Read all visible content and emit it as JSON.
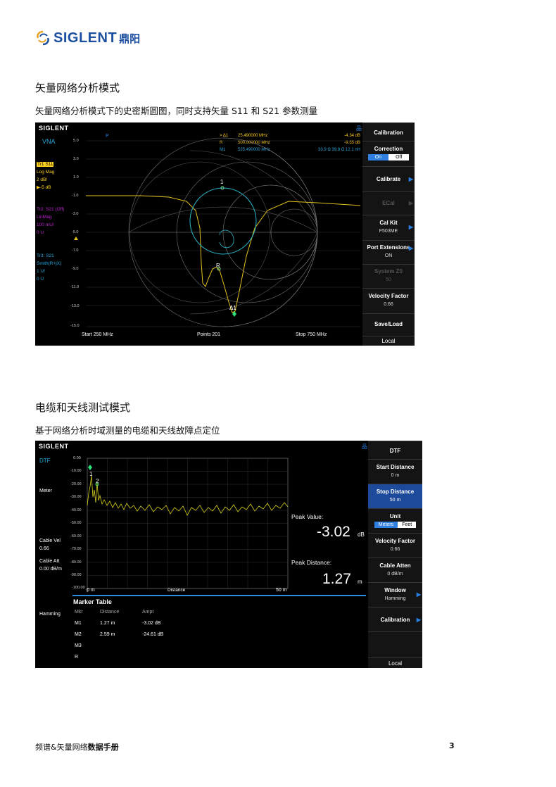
{
  "logo": {
    "brand": "SIGLENT",
    "cn": "鼎阳"
  },
  "section1": {
    "title": "矢量网络分析模式",
    "desc": "矢量网络分析模式下的史密斯圆图，同时支持矢量 S11 和 S21 参数测量"
  },
  "vna": {
    "logo": "SIGLENT",
    "mode": "VNA",
    "marker_p": "P",
    "trace1": {
      "name": "Tr1 S11",
      "fmt": "Log Mag",
      "scale": "2 dB/",
      "ref": "▶-5 dB"
    },
    "trace2": {
      "name": "Tr2: S21 (Off)",
      "fmt": "LinMag",
      "scale": "100 mU/",
      "ref": "0 U"
    },
    "trace3": {
      "name": "Tr3: S21",
      "fmt": "Smith(R+jX)",
      "scale": "1 U/",
      "ref": "0 U"
    },
    "markers": [
      {
        "id": "> Δ1",
        "freq": "25.490000 MHz",
        "val": "-4.34 dB"
      },
      {
        "id": "R",
        "freq": "500.000000 MHz",
        "val": "-9.55 dB"
      },
      {
        "id": "M1",
        "freq": "525.490000 MHz",
        "val": "33.9 Ω  39.8 Ω  12.1 nH"
      }
    ],
    "yticks": [
      "5.0",
      "3.0",
      "1.0",
      "-1.0",
      "-3.0",
      "-5.0",
      "-7.0",
      "-9.0",
      "-11.0",
      "-13.0",
      "-15.0"
    ],
    "start": "Start  250 MHz",
    "points": "Points  201",
    "stop": "Stop  750 MHz",
    "plot_labels": {
      "m1": "1",
      "r": "R",
      "d1": "Δ1"
    },
    "softkeys": {
      "calibration": "Calibration",
      "correction": "Correction",
      "on": "On",
      "off": "Off",
      "calibrate": "Calibrate",
      "ecal": "ECal",
      "calkit": "Cal Kit",
      "calkit_val": "F503ME",
      "portext": "Port Extensions",
      "portext_val": "ON",
      "systemz0": "System Z0",
      "systemz0_val": "50",
      "velocity": "Velocity Factor",
      "velocity_val": "0.66",
      "saveload": "Save/Load",
      "local": "Local"
    }
  },
  "section2": {
    "title": "电缆和天线测试模式",
    "desc": "基于网络分析时域测量的电缆和天线故障点定位"
  },
  "dtf": {
    "logo": "SIGLENT",
    "mode": "DTF",
    "meter": "Meter",
    "cable_vel": "Cable Vel",
    "cable_vel_val": "0.66",
    "cable_att": "Cable Att",
    "cable_att_val": "0.00 dB/m",
    "hamming": "Hamming",
    "yticks": [
      "0.00",
      "-10.00",
      "-20.00",
      "-30.00",
      "-40.00",
      "-50.00",
      "-60.00",
      "-70.00",
      "-80.00",
      "-90.00",
      "-100.00"
    ],
    "x_start": "0 m",
    "x_label": "Distance",
    "x_stop": "50 m",
    "peak_value_label": "Peak Value:",
    "peak_value": "-3.02",
    "peak_value_unit": "dB",
    "peak_distance_label": "Peak Distance:",
    "peak_distance": "1.27",
    "peak_distance_unit": "m",
    "plot_labels": {
      "m1": "1",
      "m2": "2"
    },
    "marker_table": {
      "title": "Marker Table",
      "headers": [
        "Mkr",
        "Distance",
        "Ampt"
      ],
      "rows": [
        [
          "M1",
          "1.27 m",
          "-3.02 dB"
        ],
        [
          "M2",
          "2.59 m",
          "-24.61 dB"
        ],
        [
          "M3",
          "",
          ""
        ],
        [
          "R",
          "",
          ""
        ]
      ]
    },
    "softkeys": {
      "title": "DTF",
      "start": "Start Distance",
      "start_val": "0 m",
      "stop": "Stop Distance",
      "stop_val": "50 m",
      "unit": "Unit",
      "meters": "Meters",
      "feet": "Feet",
      "velocity": "Velocity Factor",
      "velocity_val": "0.66",
      "atten": "Cable Atten",
      "atten_val": "0 dB/m",
      "window": "Window",
      "window_val": "Hamming",
      "calibration": "Calibration",
      "local": "Local"
    }
  },
  "footer": {
    "left_a": "频谱&矢量网络",
    "left_b": "数据手册",
    "page": "3"
  }
}
